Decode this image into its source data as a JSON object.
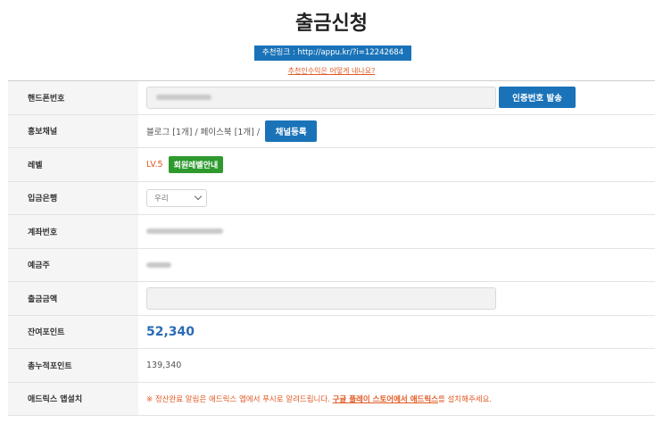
{
  "header": {
    "title": "출금신청",
    "referral_link": "추천링크 : http://appu.kr/?i=12242684",
    "referral_help": "추천인수익은 어떻게 내나요?"
  },
  "form": {
    "phone": {
      "label": "핸드폰번호",
      "button": "인증번호 발송"
    },
    "channel": {
      "label": "홍보채널",
      "value": "블로그 [1개] / 페이스북 [1개] /",
      "button": "채널등록"
    },
    "level": {
      "label": "레벨",
      "value": "LV.5",
      "button": "회원레벨안내"
    },
    "bank": {
      "label": "입금은행",
      "selected": "우리"
    },
    "account": {
      "label": "계좌번호"
    },
    "holder": {
      "label": "예금주"
    },
    "amount": {
      "label": "출금금액"
    },
    "balance": {
      "label": "잔여포인트",
      "value": "52,340"
    },
    "total": {
      "label": "총누적포인트",
      "value": "139,340"
    },
    "install": {
      "label": "애드릭스 앱설치",
      "notice_prefix": "※ 정산완료 알림은 애드릭스 앱에서 푸시로 알려드립니다.",
      "notice_link": "구글 플레이 스토어에서 애드릭스",
      "notice_suffix": "를 설치해주세요."
    }
  },
  "colors": {
    "primary": "#1a73b8",
    "accent": "#e05a24",
    "success": "#2e9a2e",
    "points": "#2a6bb5"
  }
}
